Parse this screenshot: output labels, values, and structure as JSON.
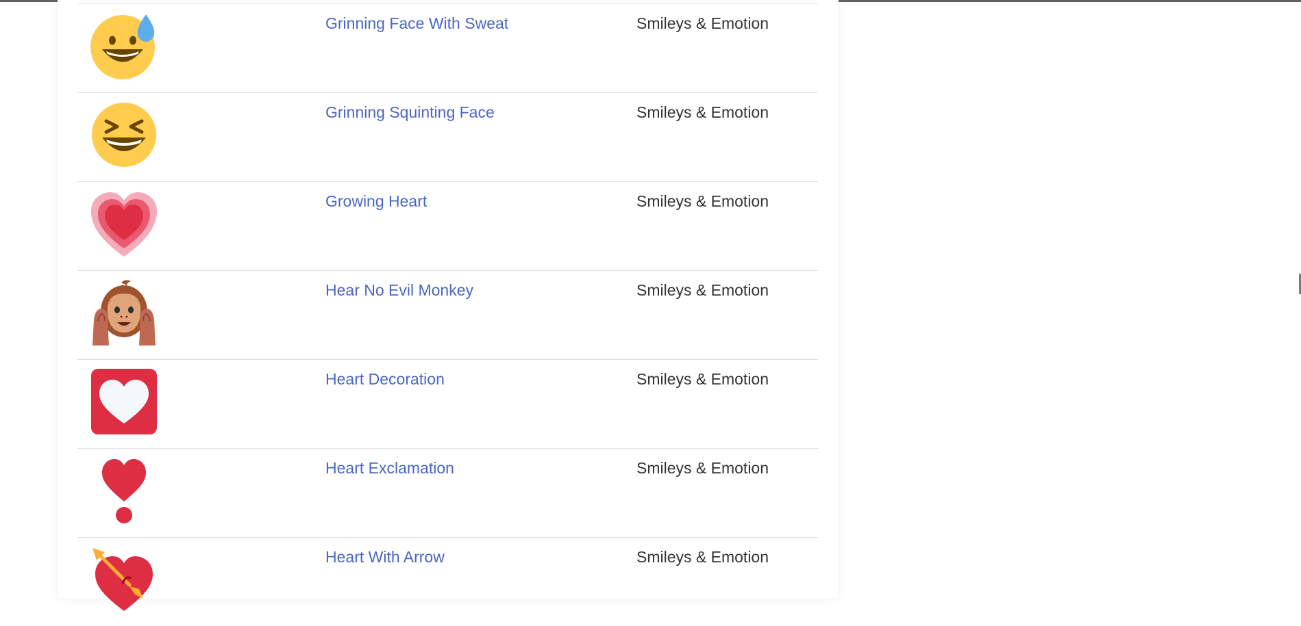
{
  "colors": {
    "link": "#4a66c4",
    "category_text": "#333333",
    "divider": "#e0e0e0"
  },
  "rows": [
    {
      "icon": "grinning-face-with-sweat-icon",
      "name": "Grinning Face With Sweat",
      "category": "Smileys & Emotion"
    },
    {
      "icon": "grinning-squinting-face-icon",
      "name": "Grinning Squinting Face",
      "category": "Smileys & Emotion"
    },
    {
      "icon": "growing-heart-icon",
      "name": "Growing Heart",
      "category": "Smileys & Emotion"
    },
    {
      "icon": "hear-no-evil-monkey-icon",
      "name": "Hear No Evil Monkey",
      "category": "Smileys & Emotion"
    },
    {
      "icon": "heart-decoration-icon",
      "name": "Heart Decoration",
      "category": "Smileys & Emotion"
    },
    {
      "icon": "heart-exclamation-icon",
      "name": "Heart Exclamation",
      "category": "Smileys & Emotion"
    },
    {
      "icon": "heart-with-arrow-icon",
      "name": "Heart With Arrow",
      "category": "Smileys & Emotion"
    }
  ]
}
